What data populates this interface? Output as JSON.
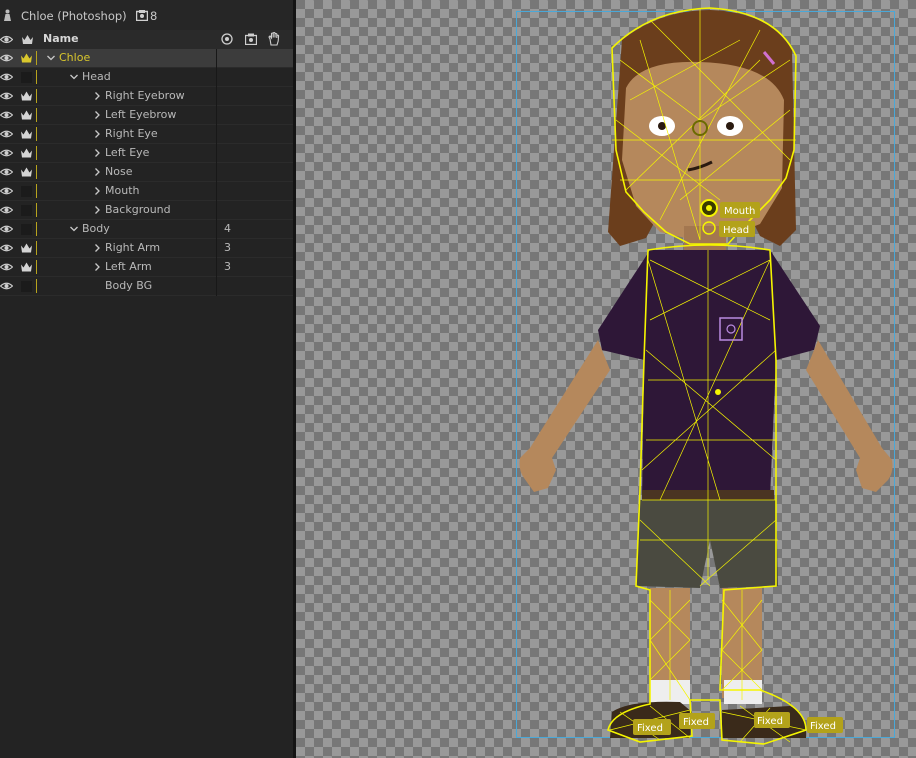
{
  "panel": {
    "title": "Chloe (Photoshop)",
    "layer_count": "8",
    "column_name": "Name",
    "icons": {
      "header": "puppet-icon",
      "count": "layers-count-icon",
      "visibility": "eye-icon",
      "independent": "crown-icon",
      "origin": "target-icon",
      "camera": "camera-icon",
      "handle": "hand-icon"
    }
  },
  "layers": [
    {
      "name": "Chloe",
      "num": "",
      "indent": 0,
      "open": true,
      "crown": true,
      "selected": true
    },
    {
      "name": "Head",
      "num": "",
      "indent": 1,
      "open": true,
      "crown": false,
      "selected": false
    },
    {
      "name": "Right Eyebrow",
      "num": "",
      "indent": 2,
      "open": false,
      "crown": true,
      "selected": false
    },
    {
      "name": "Left Eyebrow",
      "num": "",
      "indent": 2,
      "open": false,
      "crown": true,
      "selected": false
    },
    {
      "name": "Right Eye",
      "num": "",
      "indent": 2,
      "open": false,
      "crown": true,
      "selected": false
    },
    {
      "name": "Left Eye",
      "num": "",
      "indent": 2,
      "open": false,
      "crown": true,
      "selected": false
    },
    {
      "name": "Nose",
      "num": "",
      "indent": 2,
      "open": false,
      "crown": true,
      "selected": false
    },
    {
      "name": "Mouth",
      "num": "",
      "indent": 2,
      "open": false,
      "crown": false,
      "selected": false
    },
    {
      "name": "Background",
      "num": "",
      "indent": 2,
      "open": false,
      "crown": false,
      "selected": false
    },
    {
      "name": "Body",
      "num": "4",
      "indent": 1,
      "open": true,
      "crown": false,
      "selected": false
    },
    {
      "name": "Right Arm",
      "num": "3",
      "indent": 2,
      "open": false,
      "crown": true,
      "selected": false
    },
    {
      "name": "Left Arm",
      "num": "3",
      "indent": 2,
      "open": false,
      "crown": true,
      "selected": false
    },
    {
      "name": "Body BG",
      "num": "",
      "indent": 2,
      "open": null,
      "crown": false,
      "selected": false
    }
  ],
  "scene": {
    "tags": {
      "mouth": "Mouth",
      "head": "Head",
      "fixed": "Fixed"
    },
    "colors": {
      "mesh": "#f5f500",
      "hair": "#6b3e1c",
      "skin": "#b5885c",
      "shirt": "#2e1737",
      "shorts": "#4a4a40",
      "tag_bg": "#b3a21a",
      "bounds": "#4aa8d8"
    }
  }
}
